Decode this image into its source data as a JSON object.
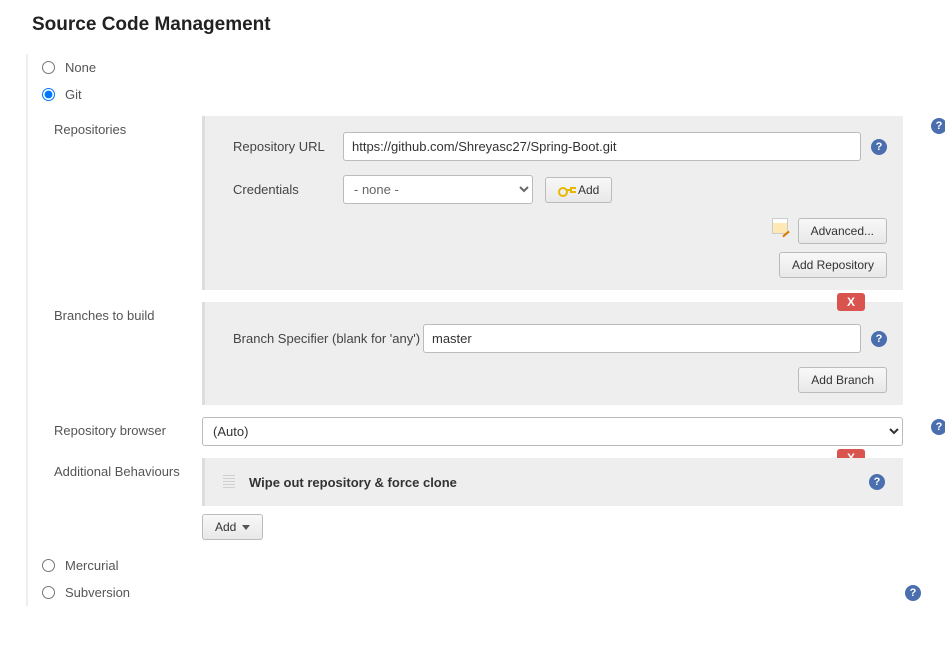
{
  "section_title": "Source Code Management",
  "scm": {
    "options": {
      "none": "None",
      "git": "Git",
      "mercurial": "Mercurial",
      "subversion": "Subversion"
    },
    "selected": "git"
  },
  "repositories": {
    "label": "Repositories",
    "repo_url": {
      "label": "Repository URL",
      "value": "https://github.com/Shreyasc27/Spring-Boot.git"
    },
    "credentials": {
      "label": "Credentials",
      "selected": "- none -",
      "add_button": "Add"
    },
    "advanced_button": "Advanced...",
    "add_repo_button": "Add Repository"
  },
  "branches": {
    "label": "Branches to build",
    "specifier_label": "Branch Specifier (blank for 'any')",
    "specifier_value": "master",
    "add_branch_button": "Add Branch",
    "delete_label": "X"
  },
  "repo_browser": {
    "label": "Repository browser",
    "selected": "(Auto)"
  },
  "behaviours": {
    "label": "Additional Behaviours",
    "items": [
      {
        "title": "Wipe out repository & force clone"
      }
    ],
    "delete_label": "X",
    "add_button": "Add"
  },
  "help_glyph": "?"
}
